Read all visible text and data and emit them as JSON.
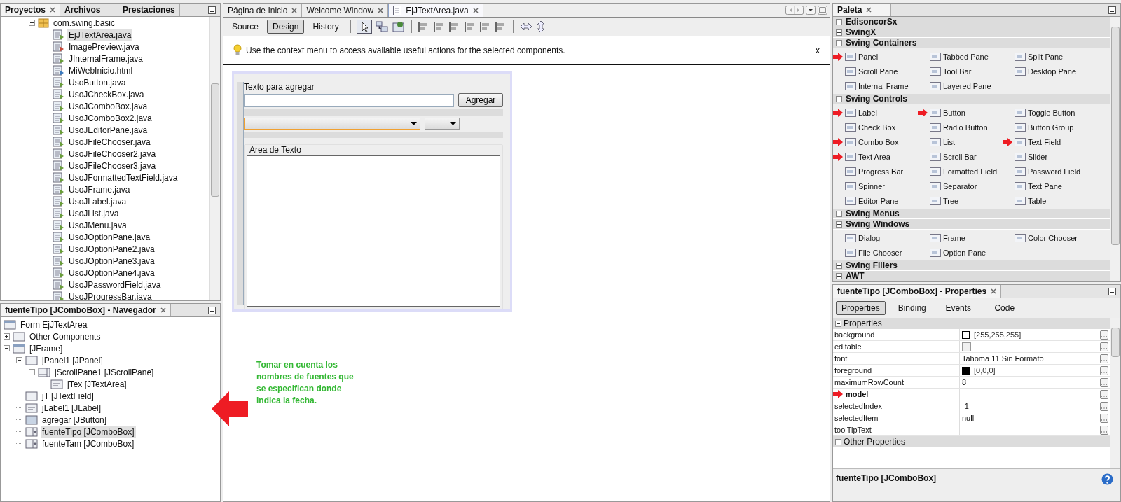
{
  "projects": {
    "tabs": [
      {
        "label": "Proyectos",
        "selected": true
      },
      {
        "label": "Archivos",
        "selected": false
      },
      {
        "label": "Prestaciones",
        "selected": false
      }
    ],
    "package": {
      "label": "com.swing.basic",
      "expanded": true
    },
    "files": [
      {
        "name": "EjJTextArea.java",
        "kind": "java",
        "selected": true
      },
      {
        "name": "ImagePreview.java",
        "kind": "image",
        "selected": false
      },
      {
        "name": "JInternalFrame.java",
        "kind": "java",
        "selected": false
      },
      {
        "name": "MiWebInicio.html",
        "kind": "html",
        "selected": false
      },
      {
        "name": "UsoButton.java",
        "kind": "java",
        "selected": false
      },
      {
        "name": "UsoJCheckBox.java",
        "kind": "java",
        "selected": false
      },
      {
        "name": "UsoJComboBox.java",
        "kind": "java",
        "selected": false
      },
      {
        "name": "UsoJComboBox2.java",
        "kind": "java",
        "selected": false
      },
      {
        "name": "UsoJEditorPane.java",
        "kind": "java",
        "selected": false
      },
      {
        "name": "UsoJFileChooser.java",
        "kind": "java",
        "selected": false
      },
      {
        "name": "UsoJFileChooser2.java",
        "kind": "java",
        "selected": false
      },
      {
        "name": "UsoJFileChooser3.java",
        "kind": "java",
        "selected": false
      },
      {
        "name": "UsoJFormattedTextField.java",
        "kind": "java",
        "selected": false
      },
      {
        "name": "UsoJFrame.java",
        "kind": "java",
        "selected": false
      },
      {
        "name": "UsoJLabel.java",
        "kind": "java",
        "selected": false
      },
      {
        "name": "UsoJList.java",
        "kind": "java",
        "selected": false
      },
      {
        "name": "UsoJMenu.java",
        "kind": "java",
        "selected": false
      },
      {
        "name": "UsoJOptionPane.java",
        "kind": "java",
        "selected": false
      },
      {
        "name": "UsoJOptionPane2.java",
        "kind": "java",
        "selected": false
      },
      {
        "name": "UsoJOptionPane3.java",
        "kind": "java",
        "selected": false
      },
      {
        "name": "UsoJOptionPane4.java",
        "kind": "java",
        "selected": false
      },
      {
        "name": "UsoJPasswordField.java",
        "kind": "java",
        "selected": false
      },
      {
        "name": "UsoJProgressBar.java",
        "kind": "java",
        "selected": false
      }
    ]
  },
  "navigator": {
    "title": "fuenteTipo [JComboBox] - Navegador",
    "tree": [
      {
        "label": "Form EjJTextArea",
        "kind": "form",
        "selected": false
      },
      {
        "label": "Other Components",
        "kind": "other",
        "selected": false,
        "expanded": false
      },
      {
        "label": "[JFrame]",
        "kind": "frame",
        "selected": false,
        "expanded": true,
        "children": [
          {
            "label": "jPanel1 [JPanel]",
            "kind": "panel",
            "selected": false,
            "expanded": true,
            "children": [
              {
                "label": "jScrollPane1 [JScrollPane]",
                "kind": "scrollpane",
                "selected": false,
                "expanded": true,
                "children": [
                  {
                    "label": "jTex [JTextArea]",
                    "kind": "textarea",
                    "selected": false
                  }
                ]
              }
            ]
          },
          {
            "label": "jT [JTextField]",
            "kind": "textfield",
            "selected": false
          },
          {
            "label": "jLabel1 [JLabel]",
            "kind": "label",
            "selected": false
          },
          {
            "label": "agregar [JButton]",
            "kind": "button",
            "selected": false
          },
          {
            "label": "fuenteTipo [JComboBox]",
            "kind": "combobox",
            "selected": true
          },
          {
            "label": "fuenteTam [JComboBox]",
            "kind": "combobox",
            "selected": false
          }
        ]
      }
    ]
  },
  "editor": {
    "tabs": [
      {
        "label": "Página de Inicio",
        "selected": false
      },
      {
        "label": "Welcome Window",
        "selected": false
      },
      {
        "label": "EjJTextArea.java",
        "selected": true
      }
    ],
    "views": [
      {
        "label": "Source",
        "selected": false
      },
      {
        "label": "Design",
        "selected": true
      },
      {
        "label": "History",
        "selected": false
      }
    ],
    "hint": "Use the context menu to access available useful actions for the selected components.",
    "hint_close": "x",
    "form": {
      "label": "Texto para agregar",
      "button": "Agregar",
      "area_title": "Area de Texto"
    },
    "note": "Tomar en cuenta los nombres de fuentes que se especifican donde indica la fecha."
  },
  "palette": {
    "title": "Paleta",
    "categories": [
      {
        "name": "EdisoncorSx",
        "expanded": false
      },
      {
        "name": "SwingX",
        "expanded": false
      },
      {
        "name": "Swing Containers",
        "expanded": true,
        "items": [
          {
            "label": "Panel",
            "marked": true
          },
          {
            "label": "Tabbed Pane",
            "marked": false
          },
          {
            "label": "Split Pane",
            "marked": false
          },
          {
            "label": "Scroll Pane",
            "marked": false
          },
          {
            "label": "Tool Bar",
            "marked": false
          },
          {
            "label": "Desktop Pane",
            "marked": false
          },
          {
            "label": "Internal Frame",
            "marked": false
          },
          {
            "label": "Layered Pane",
            "marked": false
          }
        ]
      },
      {
        "name": "Swing Controls",
        "expanded": true,
        "items": [
          {
            "label": "Label",
            "marked": true
          },
          {
            "label": "Button",
            "marked": true
          },
          {
            "label": "Toggle Button",
            "marked": false
          },
          {
            "label": "Check Box",
            "marked": false
          },
          {
            "label": "Radio Button",
            "marked": false
          },
          {
            "label": "Button Group",
            "marked": false
          },
          {
            "label": "Combo Box",
            "marked": true
          },
          {
            "label": "List",
            "marked": false
          },
          {
            "label": "Text Field",
            "marked": true
          },
          {
            "label": "Text Area",
            "marked": true
          },
          {
            "label": "Scroll Bar",
            "marked": false
          },
          {
            "label": "Slider",
            "marked": false
          },
          {
            "label": "Progress Bar",
            "marked": false
          },
          {
            "label": "Formatted Field",
            "marked": false
          },
          {
            "label": "Password Field",
            "marked": false
          },
          {
            "label": "Spinner",
            "marked": false
          },
          {
            "label": "Separator",
            "marked": false
          },
          {
            "label": "Text Pane",
            "marked": false
          },
          {
            "label": "Editor Pane",
            "marked": false
          },
          {
            "label": "Tree",
            "marked": false
          },
          {
            "label": "Table",
            "marked": false
          }
        ]
      },
      {
        "name": "Swing Menus",
        "expanded": false
      },
      {
        "name": "Swing Windows",
        "expanded": true,
        "items": [
          {
            "label": "Dialog",
            "marked": false
          },
          {
            "label": "Frame",
            "marked": false
          },
          {
            "label": "Color Chooser",
            "marked": false
          },
          {
            "label": "File Chooser",
            "marked": false
          },
          {
            "label": "Option Pane",
            "marked": false
          }
        ]
      },
      {
        "name": "Swing Fillers",
        "expanded": false
      },
      {
        "name": "AWT",
        "expanded": false
      }
    ]
  },
  "properties": {
    "title": "fuenteTipo [JComboBox] - Properties",
    "tabs": [
      {
        "label": "Properties",
        "selected": true
      },
      {
        "label": "Binding",
        "selected": false
      },
      {
        "label": "Events",
        "selected": false
      },
      {
        "label": "Code",
        "selected": false
      }
    ],
    "sections": [
      {
        "title": "Properties",
        "expanded": true,
        "rows": [
          {
            "name": "background",
            "kind": "color",
            "color": "#ffffff",
            "value": "[255,255,255]",
            "marked": false
          },
          {
            "name": "editable",
            "kind": "checkbox",
            "checked": false,
            "marked": false
          },
          {
            "name": "font",
            "kind": "text",
            "value": "Tahoma 11 Sin Formato",
            "marked": false
          },
          {
            "name": "foreground",
            "kind": "color",
            "color": "#000000",
            "value": "[0,0,0]",
            "marked": false
          },
          {
            "name": "maximumRowCount",
            "kind": "text",
            "value": "8",
            "marked": false
          },
          {
            "name": "model",
            "kind": "text",
            "marked": true
          },
          {
            "name": "selectedIndex",
            "kind": "text",
            "value": "-1",
            "marked": false
          },
          {
            "name": "selectedItem",
            "kind": "text",
            "value": "null",
            "marked": false
          },
          {
            "name": "toolTipText",
            "kind": "text",
            "marked": false
          }
        ]
      },
      {
        "title": "Other Properties",
        "expanded": true
      }
    ],
    "footer": "fuenteTipo [JComboBox]"
  }
}
